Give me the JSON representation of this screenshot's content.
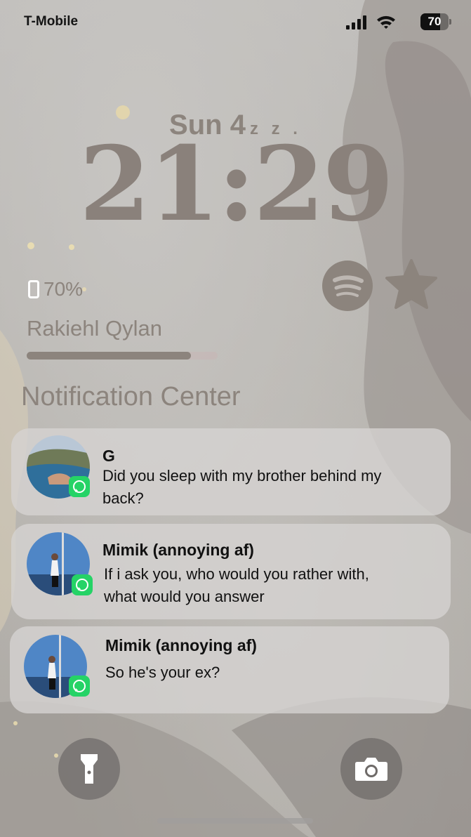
{
  "status_bar": {
    "carrier": "T-Mobile",
    "battery_level": "70",
    "battery_fraction": 0.7,
    "icons": [
      "signal-icon",
      "wifi-icon",
      "battery-icon"
    ]
  },
  "lock_screen": {
    "date": "Sun 4",
    "sleep_glyph": "z z .",
    "time": "21:29"
  },
  "widgets": {
    "battery": {
      "icon": "phone-battery-icon",
      "label": "70%"
    },
    "media": {
      "title": "Rakiehl Qylan",
      "progress": 0.86
    },
    "spotify": {
      "icon": "spotify-icon"
    },
    "favorite": {
      "icon": "star-icon"
    }
  },
  "notification_center": {
    "title": "Notification Center",
    "items": [
      {
        "app_icon": "whatsapp-icon",
        "sender": "G",
        "message_lines": [
          "Did you sleep with my brother behind my",
          "back?"
        ]
      },
      {
        "app_icon": "whatsapp-icon",
        "sender": "Mimik (annoying af)",
        "message_lines": [
          "If i ask you, who would you rather with,",
          "what would you answer"
        ]
      },
      {
        "app_icon": "whatsapp-icon",
        "sender": "Mimik (annoying af)",
        "message_lines": [
          "So he's your ex?"
        ]
      }
    ]
  },
  "bottom_controls": {
    "left": "flashlight-icon",
    "right": "camera-icon"
  },
  "colors": {
    "accent_text": "#8c847d",
    "whatsapp_green": "#25d366"
  }
}
